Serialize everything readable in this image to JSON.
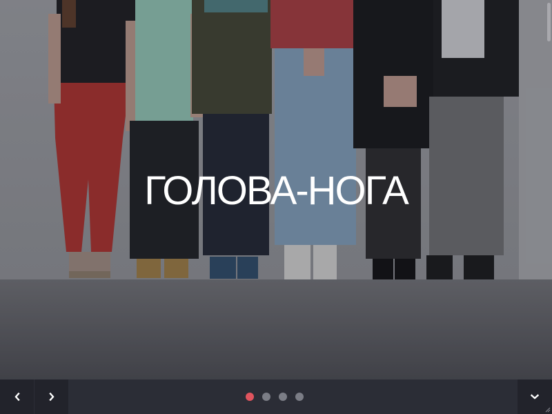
{
  "slide": {
    "title": "ГОЛОВА-НОГА"
  },
  "pager": {
    "dots": [
      {
        "active": true
      },
      {
        "active": false
      },
      {
        "active": false
      },
      {
        "active": false
      }
    ]
  },
  "icons": {
    "prev": "chevron-left-icon",
    "next": "chevron-right-icon",
    "down": "chevron-down-icon"
  },
  "colors": {
    "active_dot": "#e0545e",
    "inactive_dot": "#7b7d86",
    "bar": "#2b2d36",
    "button": "#22232b"
  }
}
